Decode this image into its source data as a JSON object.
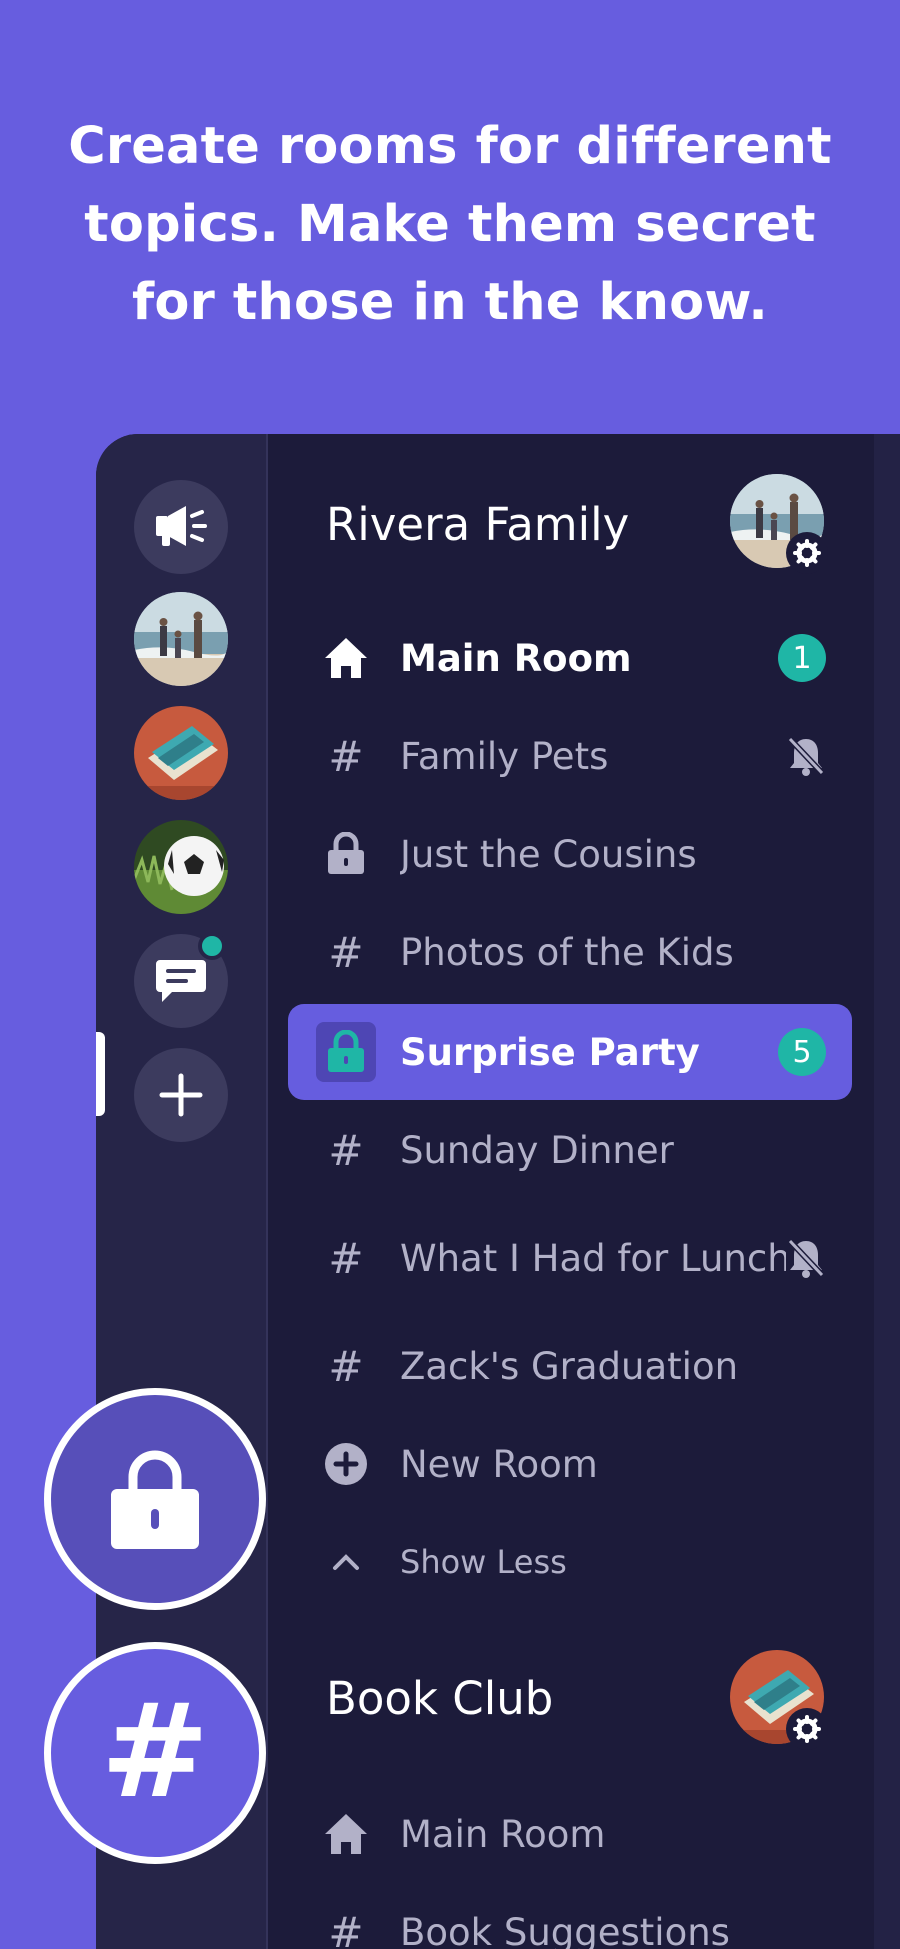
{
  "headline": "Create rooms for different topics. Make them secret for those in the know.",
  "colors": {
    "background": "#675ddf",
    "panel": "#1c1b3a",
    "rail": "#262548",
    "accent": "#665ddf",
    "badge": "#1fb6a6"
  },
  "rail": {
    "items": [
      {
        "name": "announcements",
        "icon": "megaphone-icon"
      },
      {
        "name": "rivera-family",
        "icon": "family-photo",
        "active": true
      },
      {
        "name": "book-club",
        "icon": "books-photo"
      },
      {
        "name": "soccer",
        "icon": "soccer-photo"
      },
      {
        "name": "messages",
        "icon": "chat-icon",
        "has_dot": true
      },
      {
        "name": "add-group",
        "icon": "plus-icon"
      }
    ]
  },
  "groups": [
    {
      "title": "Rivera Family",
      "rooms": [
        {
          "label": "Main Room",
          "icon": "home-icon",
          "badge": "1",
          "bold": true
        },
        {
          "label": "Family Pets",
          "icon": "hash",
          "muted": true
        },
        {
          "label": "Just the Cousins",
          "icon": "lock-icon"
        },
        {
          "label": "Photos of the Kids",
          "icon": "hash"
        },
        {
          "label": "Surprise Party",
          "icon": "lock-icon",
          "badge": "5",
          "selected": true
        },
        {
          "label": "Sunday Dinner",
          "icon": "hash"
        },
        {
          "label": "What I Had for Lunch",
          "icon": "hash",
          "muted": true
        },
        {
          "label": "Zack's Graduation",
          "icon": "hash"
        }
      ],
      "new_room": "New Room",
      "show_less": "Show Less"
    },
    {
      "title": "Book Club",
      "rooms": [
        {
          "label": "Main Room",
          "icon": "home-icon"
        },
        {
          "label": "Book Suggestions",
          "icon": "hash"
        }
      ]
    }
  ],
  "hash_symbol": "#",
  "fabs": [
    {
      "name": "secret-room",
      "icon": "lock-icon"
    },
    {
      "name": "topic-room",
      "icon": "hash"
    }
  ]
}
